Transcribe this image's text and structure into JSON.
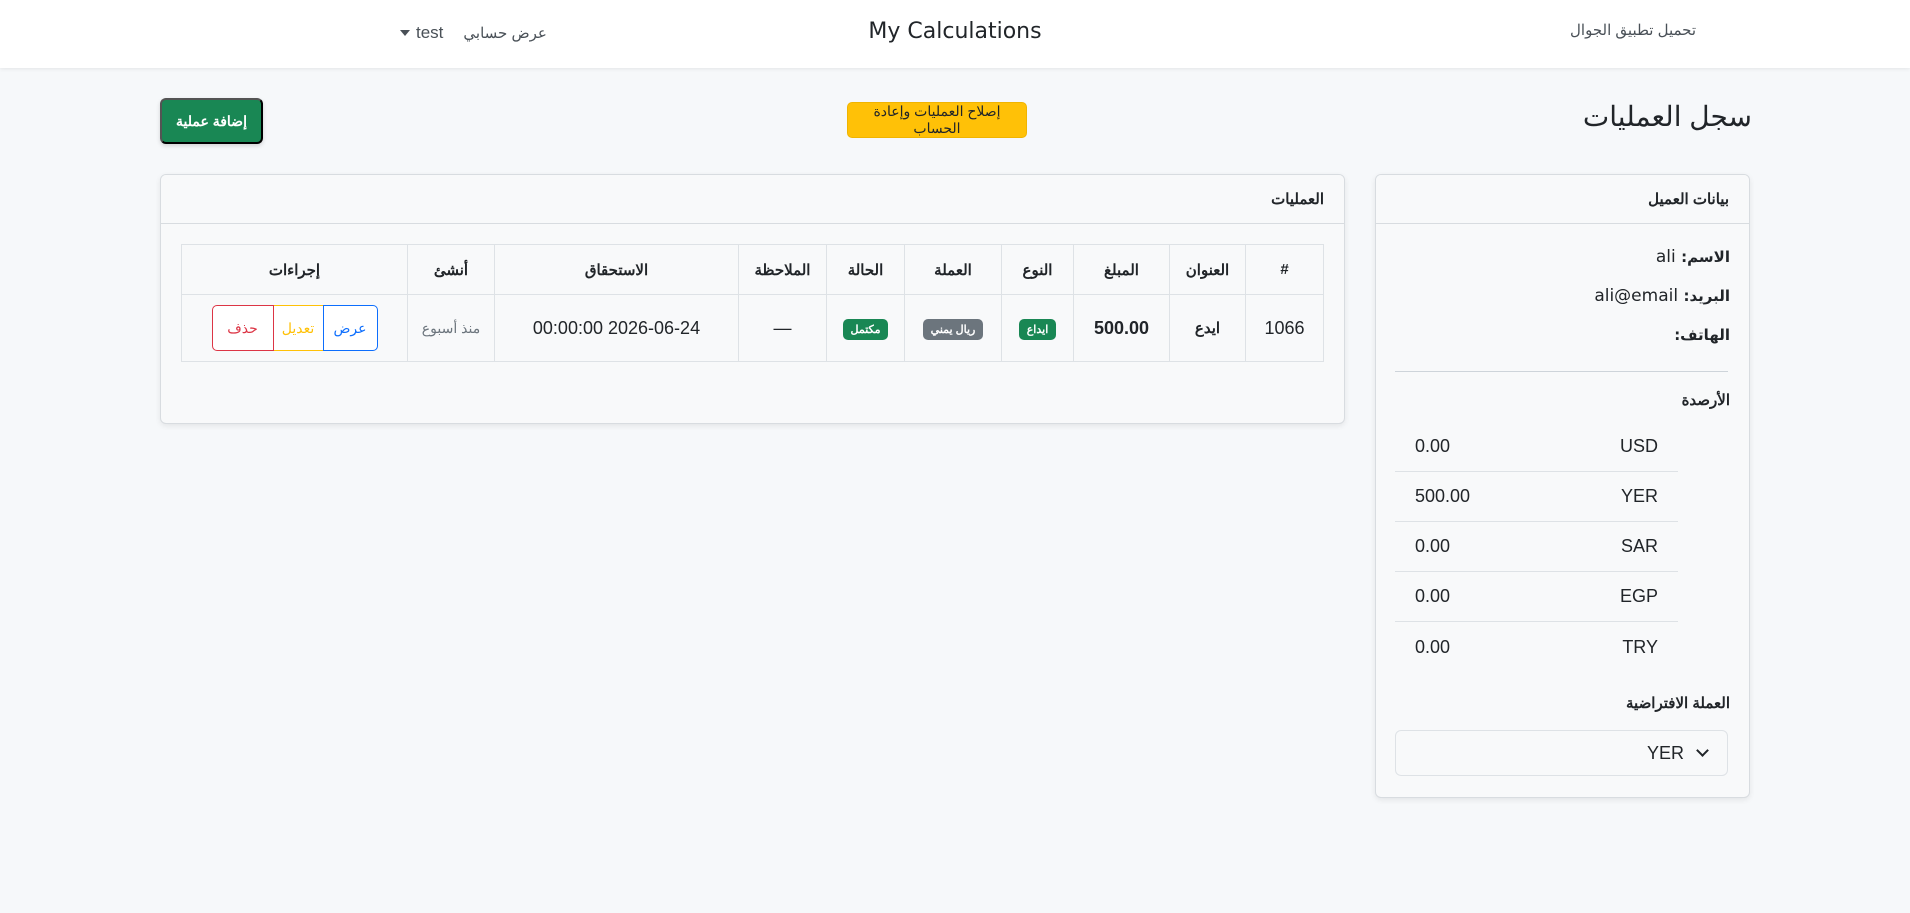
{
  "navbar": {
    "brand": "My Calculations",
    "user_name": "test",
    "account_link": "عرض حسابي",
    "mobile_link": "تحميل تطبيق الجوال"
  },
  "page": {
    "title": "سجل العمليات",
    "fix_button": "إصلاح العمليات وإعادة الحساب",
    "add_button": "إضافة عملية"
  },
  "operations": {
    "header": "العمليات",
    "columns": [
      "#",
      "العنوان",
      "المبلغ",
      "النوع",
      "العملة",
      "الحالة",
      "الملاحظة",
      "الاستحقاق",
      "أنشئ",
      "إجراءات"
    ],
    "rows": [
      {
        "id": "1066",
        "title": "ايدع",
        "amount": "500.00",
        "type": "ايداع",
        "currency": "ريال يمني",
        "status": "مكتمل",
        "note": "—",
        "due": "2026-06-24 00:00:00",
        "created": "منذ أسبوع",
        "actions": {
          "view": "عرض",
          "edit": "تعديل",
          "delete": "حذف"
        }
      }
    ]
  },
  "client": {
    "header": "بيانات العميل",
    "name_label": "الاسم:",
    "name_value": "ali",
    "email_label": "البريد:",
    "email_value": "ali@email",
    "phone_label": "الهاتف:",
    "phone_value": "",
    "balances_title": "الأرصدة",
    "balances": [
      {
        "currency": "USD",
        "amount": "0.00"
      },
      {
        "currency": "YER",
        "amount": "500.00"
      },
      {
        "currency": "SAR",
        "amount": "0.00"
      },
      {
        "currency": "EGP",
        "amount": "0.00"
      },
      {
        "currency": "TRY",
        "amount": "0.00"
      }
    ],
    "default_currency_title": "العملة الافتراضية",
    "default_currency_value": "YER"
  },
  "colors": {
    "primary_green": "#198754",
    "warning_yellow": "#ffc107",
    "danger_red": "#dc3545",
    "info_blue": "#0d6efd",
    "secondary_gray": "#6c757d"
  }
}
